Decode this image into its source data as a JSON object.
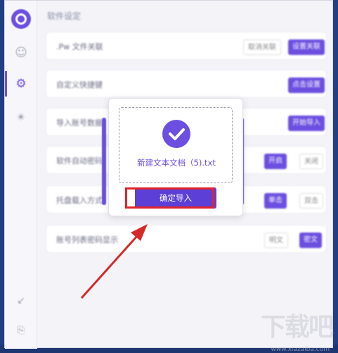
{
  "app": {
    "title": "软件设定"
  },
  "sidebar": {
    "icons": [
      "logo-icon",
      "user-icon",
      "gear-icon",
      "star-icon",
      "shrink-icon",
      "exit-icon"
    ]
  },
  "rows": [
    {
      "label": ".Pw 文件关联",
      "btn1": "取消关联",
      "btn2": "设置关联"
    },
    {
      "label": "自定义快捷键",
      "btn1": "",
      "btn2": "点击设置"
    },
    {
      "label": "导入账号数据",
      "btn1": "",
      "btn2": "开始导入"
    },
    {
      "label": "软件自动密码",
      "btn1": "开启",
      "btn2": "关闭"
    },
    {
      "label": "托盘载入方式",
      "btn1": "单击",
      "btn2": "双击"
    },
    {
      "label": "账号列表密码显示",
      "btn1": "明文",
      "btn2": "密文"
    }
  ],
  "dialog": {
    "filename": "新建文本文档（5).txt",
    "confirm": "确定导入"
  },
  "watermark": {
    "text": "下载吧",
    "url": "www.xiazaiba.com"
  },
  "colors": {
    "accent": "#6c4fe0",
    "highlight": "#e0242c",
    "arrow": "#d42a2a"
  }
}
